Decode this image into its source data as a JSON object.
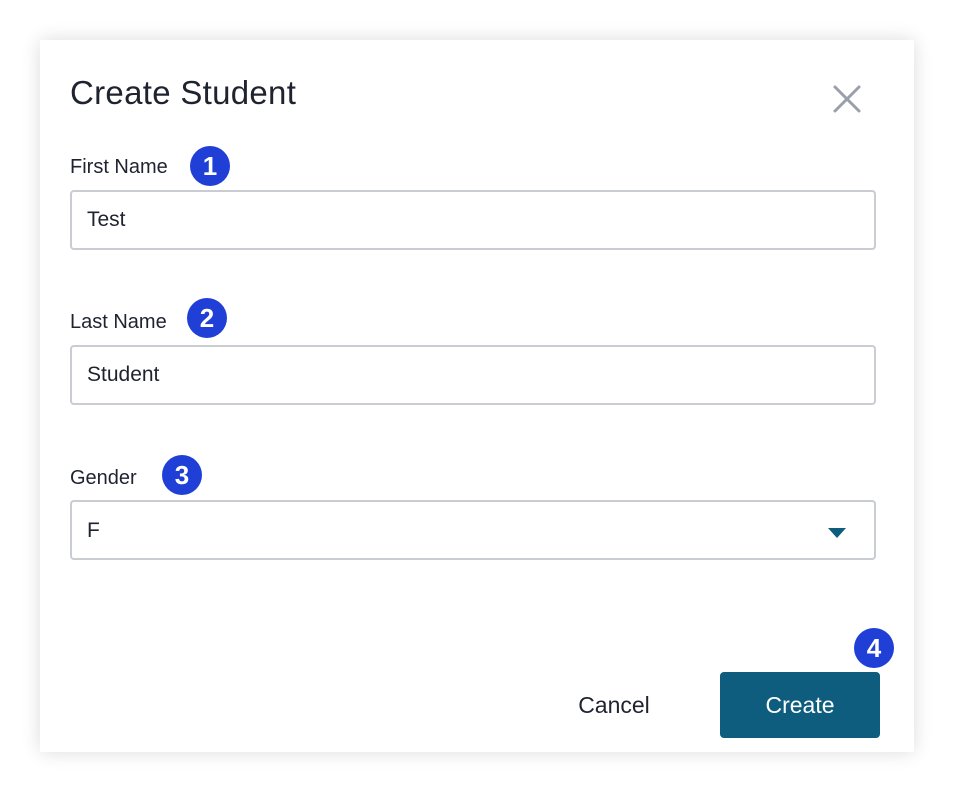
{
  "dialog": {
    "title": "Create Student",
    "close_icon": "close-icon"
  },
  "form": {
    "first_name": {
      "label": "First Name",
      "value": "Test",
      "callout": "1"
    },
    "last_name": {
      "label": "Last Name",
      "value": "Student",
      "callout": "2"
    },
    "gender": {
      "label": "Gender",
      "value": "F",
      "callout": "3",
      "icon": "chevron-down-icon"
    }
  },
  "actions": {
    "cancel_label": "Cancel",
    "create_label": "Create",
    "create_callout": "4"
  },
  "colors": {
    "primary": "#0e5c7e",
    "callout": "#1f3fd6",
    "border": "#c9ccd3",
    "text": "#1f2330"
  }
}
